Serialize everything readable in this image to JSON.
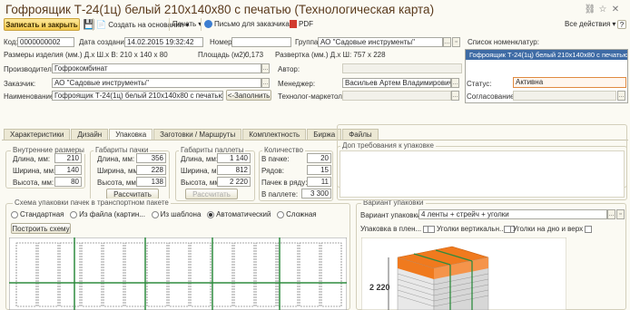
{
  "window": {
    "title": "Гофроящик Т-24(1ц) белый 210х140х80 с печатью (Технологическая карта)"
  },
  "toolbar": {
    "save_close": "Записать и закрыть",
    "create_based": "Создать на основании",
    "print": "Печать",
    "letter": "Письмо для заказчика",
    "pdf": "PDF",
    "all_actions": "Все действия",
    "help": "?"
  },
  "header": {
    "code_label": "Код:",
    "code": "0000000002",
    "created_label": "Дата создания:",
    "created": "14.02.2015 19:32:42",
    "number_label": "Номер:",
    "number": "",
    "group_label": "Группа:",
    "group": "АО \"Садовые инструменты\"",
    "nom_list_label": "Список номенклатур:",
    "nom_items": [
      "Гофроящик Т-24(1ц) белый 210х140х80 с печатью"
    ],
    "sizes_text": "Размеры изделия (мм.) Д.х Ш.х В: 210 x 140 x 80",
    "area_text": "Площадь (м2):",
    "area": "0,173",
    "scan_text": "Развертка (мм.) Д.х Ш: 757 x 228",
    "producer_label": "Производитель:",
    "producer": "Гофрокомбинат",
    "author_label": "Автор:",
    "author": "",
    "customer_label": "Заказчик:",
    "customer": "АО \"Садовые инструменты\"",
    "manager_label": "Менеджер:",
    "manager": "Васильев Артем Владимирович",
    "status_label": "Статус:",
    "status": "Активна",
    "name_label": "Наименование:",
    "name": "Гофроящик Т-24(1ц) белый 210х140х80 с печатью",
    "fill_btn": "<-Заполнить",
    "tech_label": "Технолог-маркетолог:",
    "tech": "",
    "approval_label": "Согласование:",
    "approval": ""
  },
  "tabs": [
    "Характеристики",
    "Дизайн",
    "Упаковка",
    "Заготовки / Маршруты",
    "Комплектность",
    "Биржа",
    "Файлы"
  ],
  "packing": {
    "inner": {
      "title": "Внутренние размеры",
      "length_label": "Длина, мм:",
      "length": "210",
      "width_label": "Ширина, мм:",
      "width": "140",
      "height_label": "Высота, мм:",
      "height": "80"
    },
    "pack": {
      "title": "Габариты пачки",
      "length_label": "Длина, мм:",
      "length": "356",
      "width_label": "Ширина, мм:",
      "width": "228",
      "height_label": "Высота, мм:",
      "height": "138",
      "calc": "Рассчитать"
    },
    "pallet": {
      "title": "Габариты паллеты",
      "length_label": "Длина, мм:",
      "length": "1 140",
      "width_label": "Ширина, мм:",
      "width": "812",
      "height_label": "Высота, мм:",
      "height": "2 220",
      "calc": "Рассчитать"
    },
    "qty": {
      "title": "Количество",
      "pack_label": "В пачке:",
      "pack": "20",
      "rows_label": "Рядов:",
      "rows": "15",
      "row_label": "Пачек в ряду:",
      "row": "11",
      "pallet_label": "В паллете:",
      "pallet": "3 300"
    },
    "requirements": {
      "title": "Доп требования к упаковке",
      "text": ""
    }
  },
  "scheme": {
    "title": "Схема упаковки пачек в транспортном пакете",
    "options": [
      "Стандартная",
      "Из файла (картин...",
      "Из шаблона",
      "Автоматический",
      "Сложная"
    ],
    "selected": "Автоматический",
    "build_btn": "Построить схему"
  },
  "variant": {
    "title": "Вариант упаковки",
    "label": "Вариант упаковки:",
    "value": "4 ленты + стрейч + уголки",
    "film_label": "Упаковка в плен...",
    "corners_v_label": "Уголки вертикальн...",
    "corners_bottom_label": "Уголки на дно и верх",
    "height_label": "2 220"
  },
  "colors": {
    "accent": "#f3c84a",
    "selection": "#3e6ba5",
    "title": "#5a3a1c",
    "box_orange": "#f07a1e",
    "scheme_line": "#2e8b3e"
  }
}
